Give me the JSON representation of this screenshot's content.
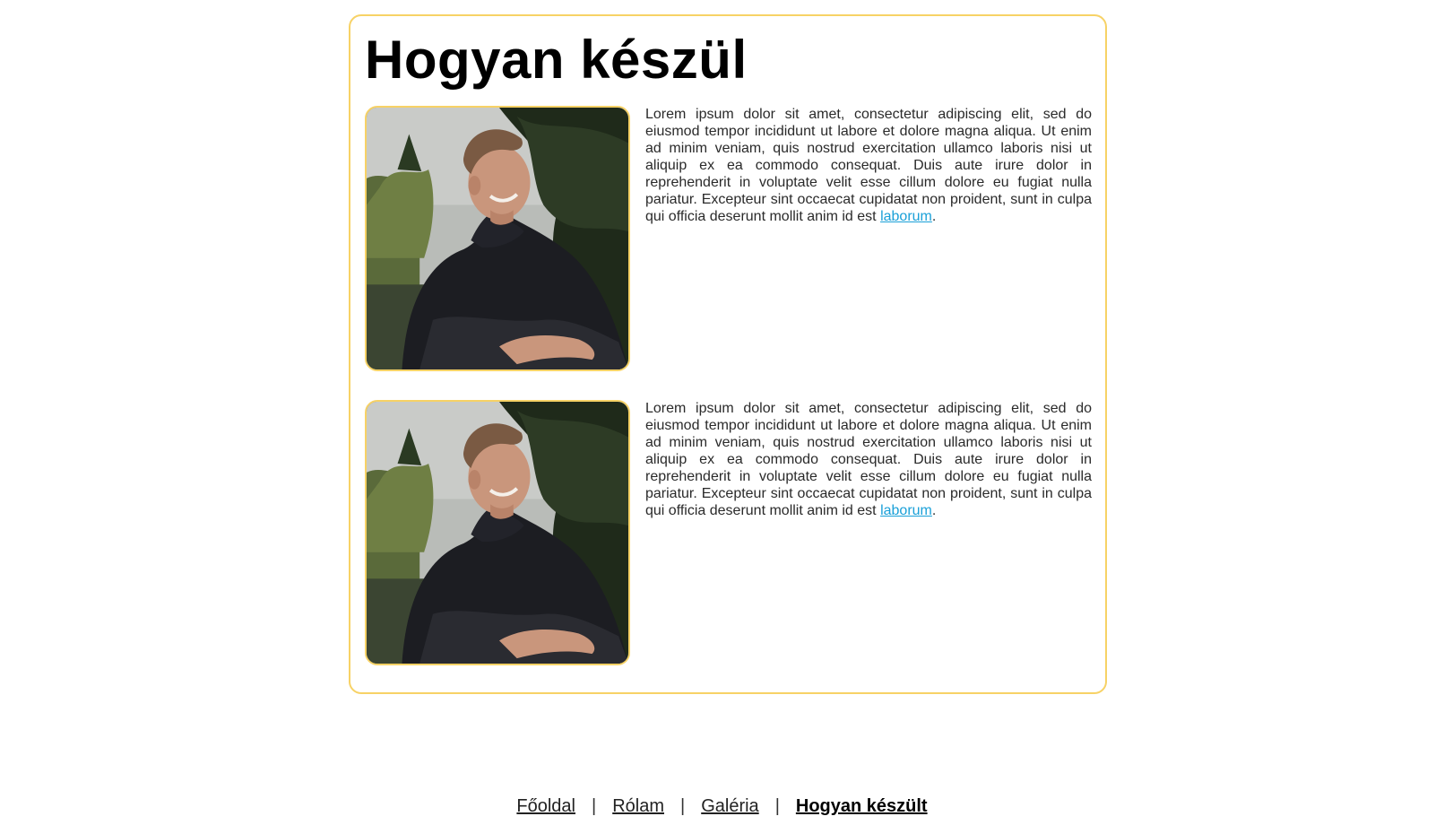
{
  "main": {
    "title": "Hogyan készül",
    "sections": [
      {
        "text": "Lorem ipsum dolor sit amet, consectetur adipiscing elit, sed do eiusmod tempor incididunt ut labore et dolore magna aliqua. Ut enim ad minim veniam, quis nostrud exercitation ullamco laboris nisi ut aliquip ex ea commodo consequat. Duis aute irure dolor in reprehenderit in voluptate velit esse cillum dolore eu fugiat nulla pariatur. Excepteur sint occaecat cupidatat non proident, sunt in culpa qui officia deserunt mollit anim id est ",
        "link_label": "laborum",
        "trailing": "."
      },
      {
        "text": "Lorem ipsum dolor sit amet, consectetur adipiscing elit, sed do eiusmod tempor incididunt ut labore et dolore magna aliqua. Ut enim ad minim veniam, quis nostrud exercitation ullamco laboris nisi ut aliquip ex ea commodo consequat. Duis aute irure dolor in reprehenderit in voluptate velit esse cillum dolore eu fugiat nulla pariatur. Excepteur sint occaecat cupidatat non proident, sunt in culpa qui officia deserunt mollit anim id est ",
        "link_label": "laborum",
        "trailing": "."
      }
    ]
  },
  "nav": {
    "items": [
      {
        "label": "Főoldal"
      },
      {
        "label": "Rólam"
      },
      {
        "label": "Galéria"
      },
      {
        "label": "Hogyan készült"
      }
    ],
    "separator": "|"
  },
  "colors": {
    "accent_border": "#f7d266",
    "link": "#1aa0d8",
    "text": "#2a2a2a"
  }
}
